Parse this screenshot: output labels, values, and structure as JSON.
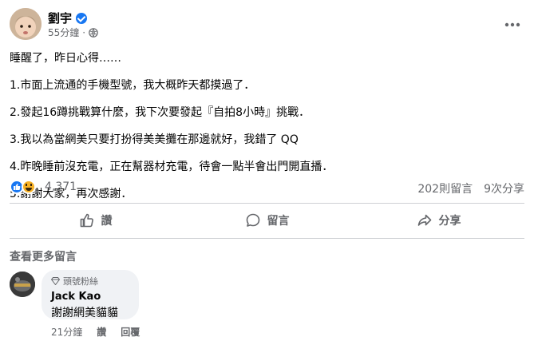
{
  "post": {
    "author": "劉宇",
    "time": "55分鐘",
    "body": [
      "睡醒了，昨日心得……",
      "1.市面上流通的手機型號，我大概昨天都摸過了．",
      "2.發起16蹲挑戰算什麼，我下次要發起『自拍8小時』挑戰．",
      "3.我以為當網美只要打扮得美美攤在那邊就好，我錯了 QQ",
      "4.昨晚睡前沒充電，正在幫器材充電，待會一點半會出門開直播．",
      "5.謝謝大家，再次感謝．"
    ],
    "reaction_count": "4,371",
    "comment_count": "202則留言",
    "share_count": "9次分享"
  },
  "actions": {
    "like": "讚",
    "comment": "留言",
    "share": "分享"
  },
  "view_more_comments": "查看更多留言",
  "comment": {
    "badge": "頭號粉絲",
    "name": "Jack Kao",
    "text": "謝謝網美貓貓",
    "time": "21分鐘",
    "like": "讚",
    "reply": "回覆"
  },
  "colors": {
    "brand_blue": "#1877f2",
    "secondary_text": "#65676b",
    "divider": "#ced0d4",
    "bubble_bg": "#f0f2f5"
  },
  "icons": [
    "verified-badge-icon",
    "globe-icon",
    "more-options-icon",
    "like-reaction-icon",
    "haha-reaction-icon",
    "thumbs-up-icon",
    "comment-icon",
    "share-icon",
    "diamond-icon"
  ]
}
